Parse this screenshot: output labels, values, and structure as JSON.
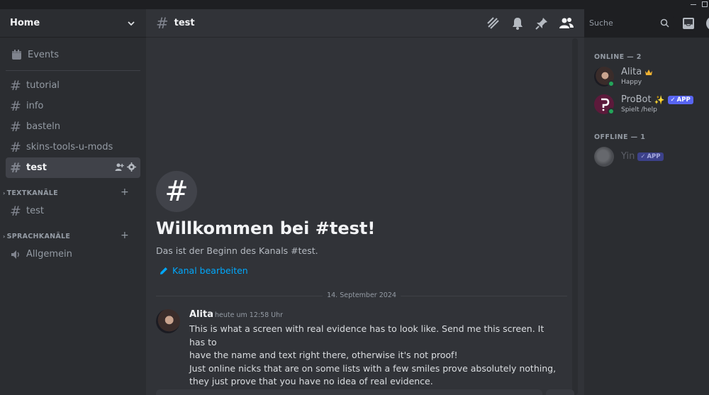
{
  "server": {
    "name": "Home"
  },
  "sidebar": {
    "events_label": "Events",
    "channels": [
      {
        "label": "tutorial"
      },
      {
        "label": "info"
      },
      {
        "label": "basteln"
      },
      {
        "label": "skins-tools-u-mods"
      },
      {
        "label": "test"
      }
    ],
    "categories": [
      {
        "label": "TEXTKANÄLE",
        "channel": "test"
      },
      {
        "label": "SPRACHKANÄLE",
        "channel": "Allgemein"
      }
    ]
  },
  "header": {
    "channel_name": "test",
    "search_placeholder": "Suche"
  },
  "welcome": {
    "icon": "#",
    "title": "Willkommen bei #test!",
    "subtitle": "Das ist der Beginn des Kanals #test.",
    "edit_label": "Kanal bearbeiten"
  },
  "messages": {
    "date_separator": "14. September 2024",
    "items": [
      {
        "author": "Alita",
        "time": "heute um 12:58 Uhr",
        "lines": [
          "This is what a screen with real evidence has to look like. Send me this screen. It has to",
          "have the name and text right there, otherwise it's not proof!",
          "Just online nicks that are on some lists with a few smiles prove absolutely nothing,",
          "they just prove that you have no idea of real evidence."
        ]
      }
    ]
  },
  "members": {
    "online_header": "ONLINE — 2",
    "offline_header": "OFFLINE — 1",
    "online": [
      {
        "name": "Alita",
        "status": "Happy",
        "badge_icon": "crown-icon"
      },
      {
        "name": "ProBot",
        "status": "Spielt /help",
        "badge_icon": "sparkles-icon",
        "app_label": "APP"
      }
    ],
    "offline": [
      {
        "name": "Yin",
        "app_label": "APP"
      }
    ]
  },
  "colors": {
    "accent": "#5865f2",
    "online": "#23a55a",
    "link": "#00a8fc",
    "crown": "#f0b232"
  }
}
